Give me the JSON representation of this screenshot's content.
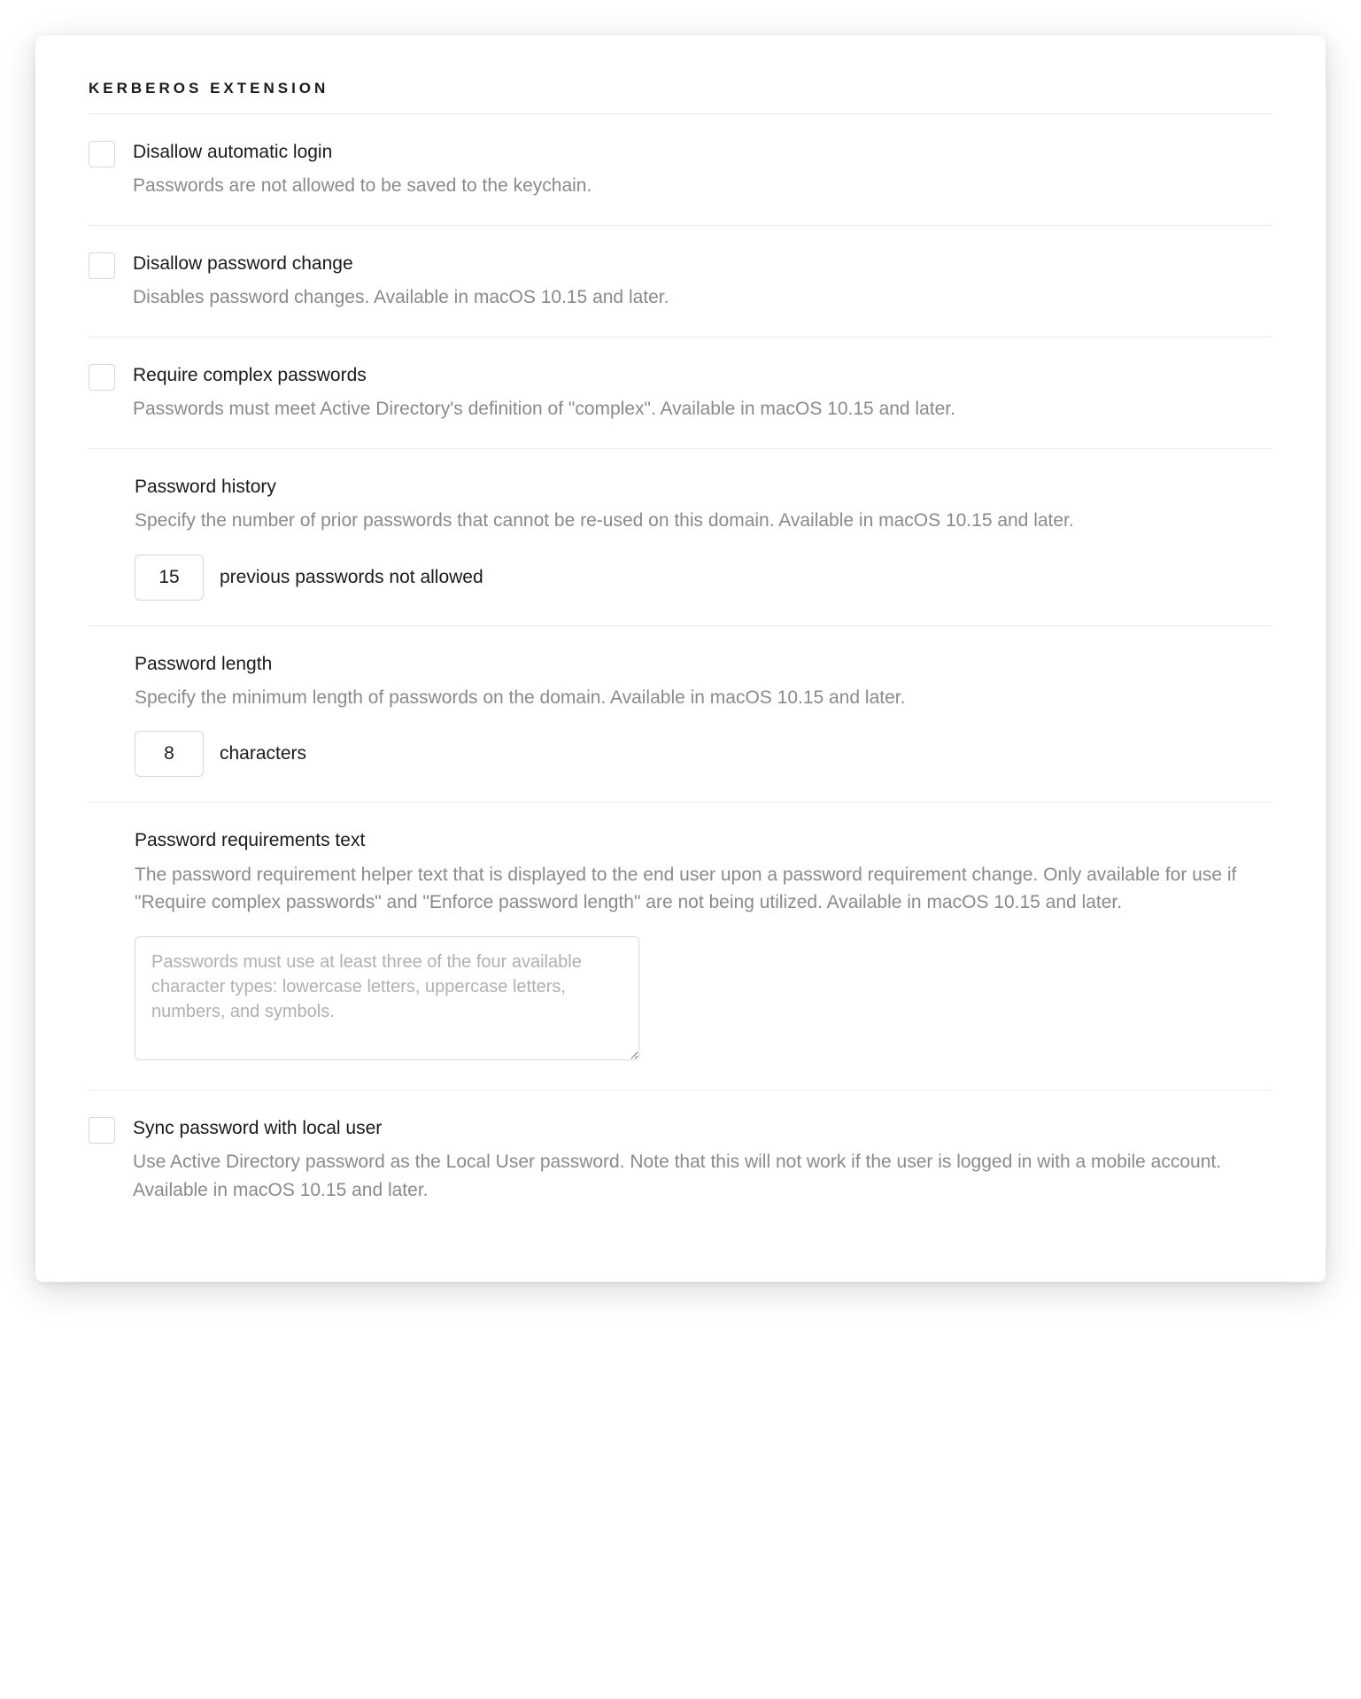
{
  "header": "Kerberos Extension",
  "settings": {
    "disallow_auto_login": {
      "title": "Disallow automatic login",
      "desc": "Passwords are not allowed to be saved to the keychain."
    },
    "disallow_password_change": {
      "title": "Disallow password change",
      "desc": "Disables password changes. Available in macOS 10.15 and later."
    },
    "require_complex": {
      "title": "Require complex passwords",
      "desc": "Passwords must meet Active Directory's definition of \"complex\". Available in macOS 10.15 and later."
    },
    "password_history": {
      "title": "Password history",
      "desc": "Specify the number of prior passwords that cannot be re-used on this domain. Available in macOS 10.15 and later.",
      "value": "15",
      "suffix": "previous passwords not allowed"
    },
    "password_length": {
      "title": "Password length",
      "desc": "Specify the minimum length of passwords on the domain. Available in macOS 10.15 and later.",
      "value": "8",
      "suffix": "characters"
    },
    "password_requirements_text": {
      "title": "Password requirements text",
      "desc": "The password requirement helper text that is displayed to the end user upon a password requirement change. Only available for use if \"Require complex passwords\" and \"Enforce password length\" are not being utilized. Available in macOS 10.15 and later.",
      "placeholder": "Passwords must use at least three of the four available character types: lowercase letters, uppercase letters, numbers, and symbols."
    },
    "sync_password": {
      "title": "Sync password with local user",
      "desc": "Use Active Directory password as the Local User password. Note that this will not work if the user is logged in with a mobile account. Available in macOS 10.15 and later."
    }
  }
}
